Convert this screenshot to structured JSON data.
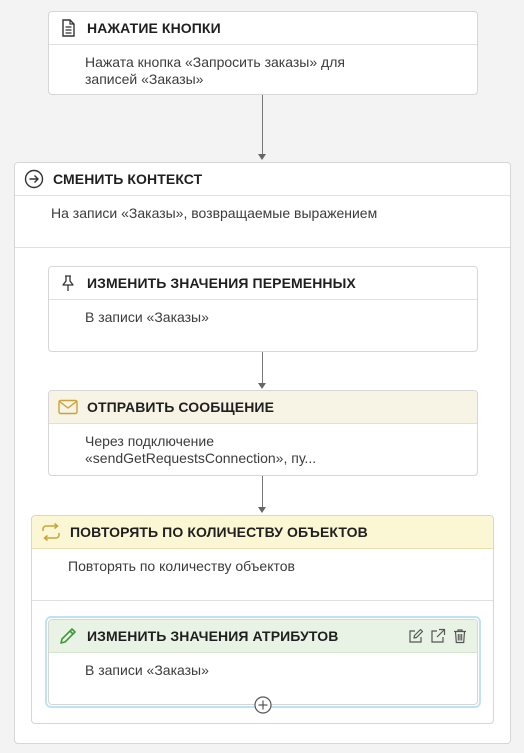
{
  "blocks": {
    "button_press": {
      "title": "НАЖАТИЕ КНОПКИ",
      "body": "Нажата кнопка «Запросить заказы» для записей «Заказы»"
    },
    "change_context": {
      "title": "СМЕНИТЬ КОНТЕКСТ",
      "body": "На записи «Заказы», возвращаемые выражением"
    },
    "change_variables": {
      "title": "ИЗМЕНИТЬ ЗНАЧЕНИЯ ПЕРЕМЕННЫХ",
      "body": "В записи «Заказы»"
    },
    "send_message": {
      "title": "ОТПРАВИТЬ СООБЩЕНИЕ",
      "body": "Через подключение «sendGetRequestsConnection», пу..."
    },
    "repeat": {
      "title": "ПОВТОРЯТЬ ПО КОЛИЧЕСТВУ ОБЪЕКТОВ",
      "body": "Повторять по количеству объектов"
    },
    "change_attributes": {
      "title": "ИЗМЕНИТЬ ЗНАЧЕНИЯ АТРИБУТОВ",
      "body": "В записи «Заказы»"
    }
  },
  "colors": {
    "send_header": "#f7f4e6",
    "repeat_header": "#fbf6d4",
    "attributes_header": "#e9f3e5",
    "selected_outline": "#bfe3f2"
  },
  "icons": {
    "button_press": "document-icon",
    "change_context": "arrow-right-circle-icon",
    "change_variables": "pin-icon",
    "send_message": "envelope-icon",
    "repeat": "repeat-icon",
    "change_attributes": "pencil-icon",
    "edit": "edit-icon",
    "open": "external-link-icon",
    "delete": "trash-icon",
    "add": "plus-circle-icon"
  }
}
